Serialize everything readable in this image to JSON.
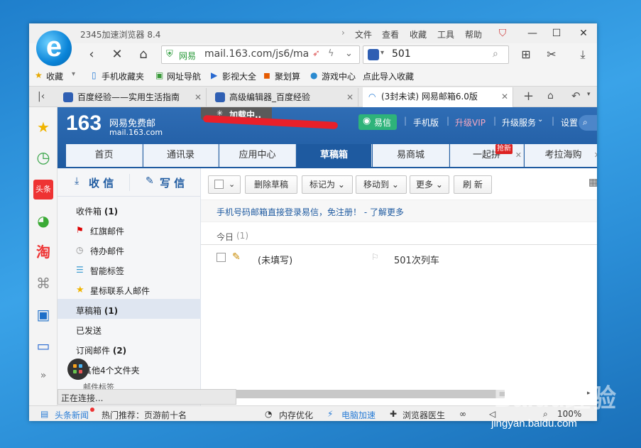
{
  "browser": {
    "title": "2345加速浏览器 8.4",
    "menu": [
      "文件",
      "查看",
      "收藏",
      "工具",
      "帮助"
    ],
    "url_site": "网易",
    "url": "mail.163.com/js6/ma",
    "search_value": "501"
  },
  "favorites": {
    "label": "收藏",
    "items": [
      "手机收藏夹",
      "网址导航",
      "影视大全",
      "聚划算",
      "游戏中心",
      "点此导入收藏"
    ]
  },
  "tabs": [
    {
      "label": "百度经验——实用生活指南"
    },
    {
      "label": "高级编辑器_百度经验"
    },
    {
      "label": "(3封未读) 网易邮箱6.0版"
    }
  ],
  "mail": {
    "logo_num": "163",
    "logo_name": "网易免费邮",
    "logo_domain": "mail.163.com",
    "loading": "加载中..",
    "yixin": "易信",
    "header_links": [
      "手机版",
      "升级VIP",
      "升级服务",
      "设置"
    ],
    "nav_tabs": [
      "首页",
      "通讯录",
      "应用中心",
      "草稿箱",
      "易商城",
      "一起拼",
      "考拉海购"
    ],
    "nav_badge": "抢新",
    "receive": "收 信",
    "write": "写 信",
    "folders": [
      {
        "label": "收件箱",
        "count": "(1)"
      },
      {
        "label": "红旗邮件",
        "count": ""
      },
      {
        "label": "待办邮件",
        "count": ""
      },
      {
        "label": "智能标签",
        "count": ""
      },
      {
        "label": "星标联系人邮件",
        "count": ""
      },
      {
        "label": "草稿箱",
        "count": "(1)"
      },
      {
        "label": "已发送",
        "count": ""
      },
      {
        "label": "订阅邮件",
        "count": "(2)"
      },
      {
        "label": "其他4个文件夹",
        "count": ""
      },
      {
        "label": "邮件标签",
        "count": ""
      }
    ],
    "toolbar": [
      "删除草稿",
      "标记为",
      "移动到",
      "更多",
      "刷 新"
    ],
    "notice": "手机号码邮箱直接登录易信，免注册！ - 了解更多",
    "group_label": "今日",
    "group_count": "(1)",
    "draft": {
      "recipient": "(未填写)",
      "subject": "501次列车"
    }
  },
  "status": {
    "connecting": "正在连接...",
    "news": "头条新闻",
    "hot": "热门推荐：页游前十名",
    "mem": "内存优化",
    "speed": "电脑加速",
    "doctor": "浏览器医生",
    "zoom": "100%"
  },
  "watermark": {
    "brand": "Baidu经验",
    "url": "jingyan.baidu.com"
  }
}
